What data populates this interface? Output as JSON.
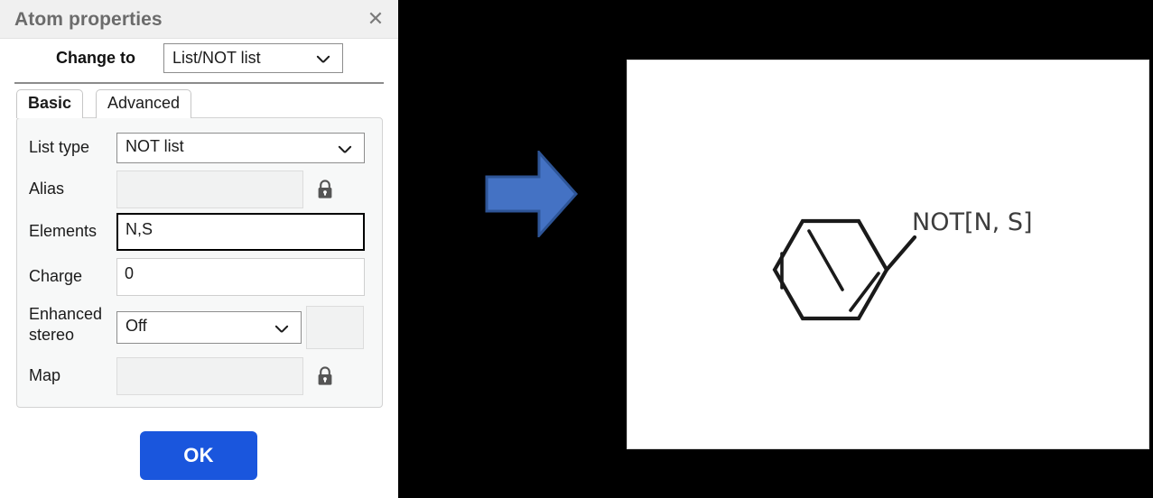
{
  "dialog": {
    "title": "Atom properties",
    "close_icon": "close-icon",
    "change_to": {
      "label": "Change to",
      "value": "List/NOT list"
    },
    "tabs": [
      {
        "label": "Basic",
        "active": true
      },
      {
        "label": "Advanced",
        "active": false
      }
    ],
    "fields": {
      "list_type": {
        "label": "List type",
        "value": "NOT list"
      },
      "alias": {
        "label": "Alias",
        "value": "",
        "locked": true,
        "lock_icon": "lock-icon"
      },
      "elements": {
        "label": "Elements",
        "value": "N,S",
        "focused": true
      },
      "charge": {
        "label": "Charge",
        "value": "0"
      },
      "enhanced_stereo": {
        "label": "Enhanced stereo",
        "label_line1": "Enhanced",
        "label_line2": "stereo",
        "value": "Off",
        "extra_value": ""
      },
      "map": {
        "label": "Map",
        "value": "",
        "locked": true,
        "lock_icon": "lock-icon"
      }
    },
    "ok_button": "OK"
  },
  "canvas": {
    "arrow_icon": "right-arrow-icon",
    "arrow_fill": "#4472c4",
    "arrow_stroke": "#2e5597",
    "molecule": {
      "label": "NOT[N, S]",
      "structure": "benzene-ring",
      "bond_color": "#1a1a1a"
    },
    "background": "#000000",
    "sheet_background": "#ffffff"
  }
}
